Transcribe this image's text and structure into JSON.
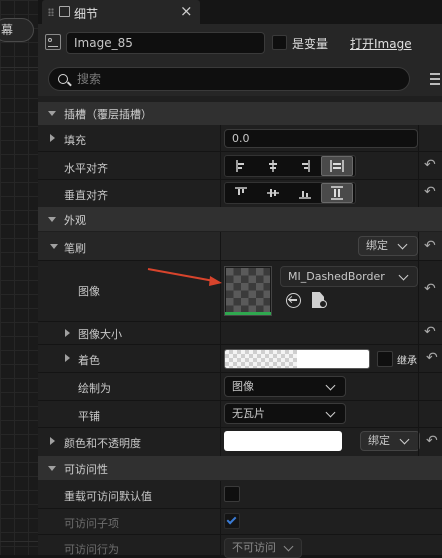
{
  "left": {
    "button_label": "幕"
  },
  "tab": {
    "title": "细节"
  },
  "header": {
    "name_value": "Image_85",
    "is_variable_label": "是变量",
    "open_link": "打开Image"
  },
  "search": {
    "placeholder": "搜索"
  },
  "slot_section": {
    "title": "插槽（覆层插槽）",
    "padding_label": "填充",
    "padding_value": "0.0",
    "h_align_label": "水平对齐",
    "v_align_label": "垂直对齐"
  },
  "appearance_section": {
    "title": "外观",
    "brush_label": "笔刷",
    "bind_label": "绑定",
    "image_label": "图像",
    "image_asset": "MI_DashedBorder",
    "image_size_label": "图像大小",
    "tint_label": "着色",
    "inherit_label": "继承",
    "draw_as_label": "绘制为",
    "draw_as_value": "图像",
    "tiling_label": "平铺",
    "tiling_value": "无瓦片",
    "color_opacity_label": "颜色和不透明度",
    "color_bind_label": "绑定"
  },
  "accessibility_section": {
    "title": "可访问性",
    "override_label": "重载可访问默认值",
    "children_label": "可访问子项",
    "behavior_label": "可访问行为",
    "behavior_value": "不可访问"
  },
  "colors": {
    "accent_green": "#2fa84f",
    "arrow_red": "#d8442c",
    "check_blue": "#3a7bd5"
  }
}
